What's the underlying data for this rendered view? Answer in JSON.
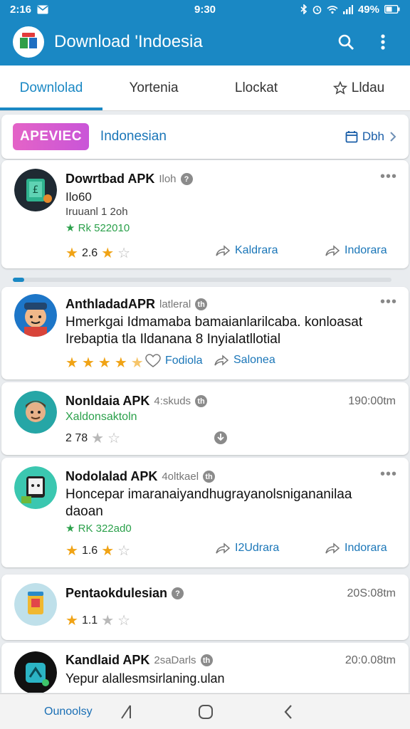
{
  "status_bar": {
    "time": "2:16",
    "center": "9:30",
    "battery": "49%"
  },
  "app_bar": {
    "title": "Download 'Indoesia"
  },
  "tabs": [
    {
      "label": "Downlolad",
      "active": true
    },
    {
      "label": "Yortenia",
      "active": false
    },
    {
      "label": "Llockat",
      "active": false
    },
    {
      "label": "Lldau",
      "active": false
    }
  ],
  "promo": {
    "badge": "APEVIEC",
    "text": "Indonesian",
    "link": "Dbh"
  },
  "cards": [
    {
      "title": "Dowrtbad APK",
      "subtitle": "Iloh",
      "line1": "Ilo60",
      "line2": "Iruuanl 1 2oh",
      "line3": "★ Rk 522010",
      "rating": "2.6",
      "stars": 1,
      "action1": "Kaldrara",
      "action2": "Indorara"
    },
    {
      "title": "AnthladadAPR",
      "subtitle": "latleral",
      "desc": "Hmerkgai Idmamaba bamaianlarilcaba. konloasat Irebaptia tla Ildanana 8 Inyialatllotial",
      "stars": 4.5,
      "action1": "Fodiola",
      "action2": "Salonea"
    },
    {
      "title": "Nonldaia APK",
      "subtitle": "4:skuds",
      "time": "190:00tm",
      "line1": "Xaldonsaktoln",
      "rating": "2 78",
      "stars": 0
    },
    {
      "title": "Nodolalad APK",
      "subtitle": "4oltkael",
      "desc": "Honcepar imaranaiyandhugrayanolsnigananilaa daoan",
      "line3": "★ RK 322ad0",
      "rating": "1.6",
      "stars": 1,
      "action1": "I2Udrara",
      "action2": "Indorara"
    },
    {
      "title": "Pentaokdulesian",
      "subtitle": "",
      "time": "20S:08tm",
      "rating": "1.1",
      "stars": 1
    },
    {
      "title": "Kandlaid APK",
      "subtitle": "2saDarls",
      "time": "20:0.08tm",
      "desc": "Yepur alallesmsirlaning.ulan"
    }
  ],
  "progress_fraction": 0.03,
  "nav": {
    "label": "Ounoolsy"
  },
  "colors": {
    "primary": "#1a88c4",
    "star": "#f0a315",
    "green": "#2aa04a",
    "promo": "#d85bd0"
  }
}
